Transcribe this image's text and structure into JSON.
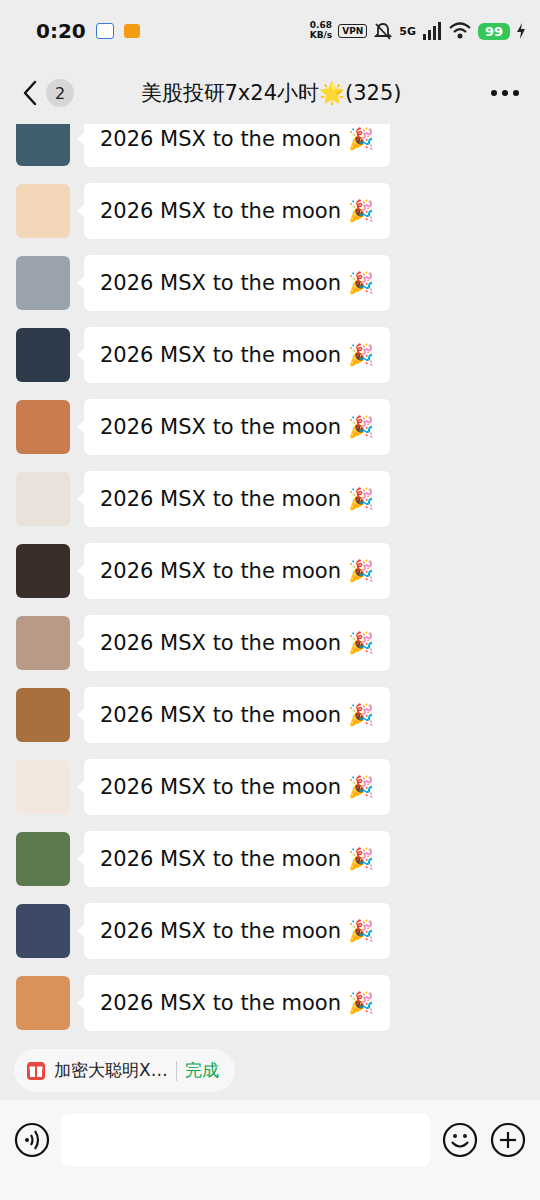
{
  "status_bar": {
    "time": "0:20",
    "speed": "0.68",
    "speed_unit": "KB/s",
    "vpn": "VPN",
    "network": "5G",
    "battery": "99"
  },
  "header": {
    "back_badge": "2",
    "title": "美股投研7x24小时🌟(325)"
  },
  "messages": [
    {
      "text": "2026 MSX to the moon 🎉"
    },
    {
      "text": "2026 MSX to the moon 🎉"
    },
    {
      "text": "2026 MSX to the moon 🎉"
    },
    {
      "text": "2026 MSX to the moon 🎉"
    },
    {
      "text": "2026 MSX to the moon 🎉"
    },
    {
      "text": "2026 MSX to the moon 🎉"
    },
    {
      "text": "2026 MSX to the moon 🎉"
    },
    {
      "text": "2026 MSX to the moon 🎉"
    },
    {
      "text": "2026 MSX to the moon 🎉"
    },
    {
      "text": "2026 MSX to the moon 🎉"
    },
    {
      "text": "2026 MSX to the moon 🎉"
    },
    {
      "text": "2026 MSX to the moon 🎉"
    },
    {
      "text": "2026 MSX to the moon 🎉"
    }
  ],
  "quote": {
    "text": "加密大聪明X…",
    "action": "完成"
  }
}
